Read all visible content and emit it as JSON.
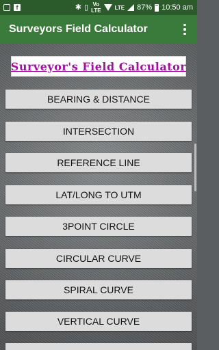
{
  "status_bar": {
    "left_icons": [
      "notification-icon",
      "facebook-icon"
    ],
    "right_icons": [
      "bluetooth-icon",
      "vibrate-icon",
      "volte-icon",
      "wifi-icon",
      "lte-icon",
      "signal-icon",
      "battery-icon"
    ],
    "fb_glyph": "f",
    "volte_label": "Vo)\nLTE",
    "lte_label": "LTE",
    "battery_percent": "87%",
    "time": "10:50 am"
  },
  "app_bar": {
    "title": "Surveyors Field Calculator",
    "background": "#3a7a3a",
    "overflow_icon": "more-vert-icon"
  },
  "banner": {
    "text": "Surveyor's Field Calculator",
    "color": "#a30fa3"
  },
  "menu": {
    "items": [
      {
        "label": "BEARING & DISTANCE"
      },
      {
        "label": "INTERSECTION"
      },
      {
        "label": "REFERENCE LINE"
      },
      {
        "label": "LAT/LONG TO UTM"
      },
      {
        "label": "3POINT CIRCLE"
      },
      {
        "label": "CIRCULAR CURVE"
      },
      {
        "label": "SPIRAL CURVE"
      },
      {
        "label": "VERTICAL CURVE"
      }
    ]
  }
}
